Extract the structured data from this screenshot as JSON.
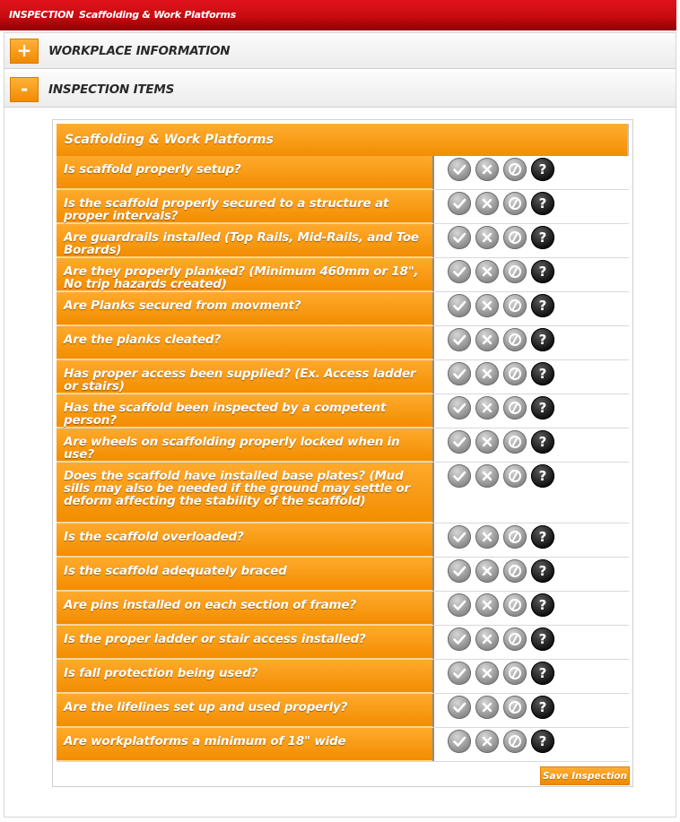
{
  "header": {
    "prefix": "INSPECTION",
    "title": "Scaffolding & Work Platforms"
  },
  "sections": [
    {
      "toggle": "+",
      "label": "WORKPLACE INFORMATION"
    },
    {
      "toggle": "-",
      "label": "INSPECTION ITEMS"
    }
  ],
  "panel": {
    "title": "Scaffolding & Work Platforms",
    "questions": [
      "Is scaffold properly setup?",
      "Is the scaffold properly secured to a structure at proper intervals?",
      "Are guardrails installed (Top Rails, Mid-Rails, and Toe Borards)",
      "Are they properly planked? (Minimum 460mm or 18\", No trip hazards created)",
      "Are Planks secured from movment?",
      "Are the planks cleated?",
      "Has proper access been supplied? (Ex. Access ladder or stairs)",
      "Has the scaffold been inspected by a competent person?",
      "Are wheels on scaffolding properly locked when in use?",
      "Does the scaffold have installed base plates? (Mud sills may also be needed if the ground may settle or deform affecting the stability of the scaffold)",
      "Is the scaffold overloaded?",
      "Is the scaffold adequately braced",
      "Are pins installed on each section of frame?",
      "Is the proper ladder or stair access installed?",
      "Is fall protection being used?",
      "Are the lifelines set up and used properly?",
      "Are workplatforms a minimum of 18\" wide"
    ],
    "answer_icons": [
      "check-icon",
      "x-icon",
      "not-applicable-icon",
      "help-icon"
    ],
    "help_glyph": "?",
    "save_label": "Save Inspection"
  }
}
